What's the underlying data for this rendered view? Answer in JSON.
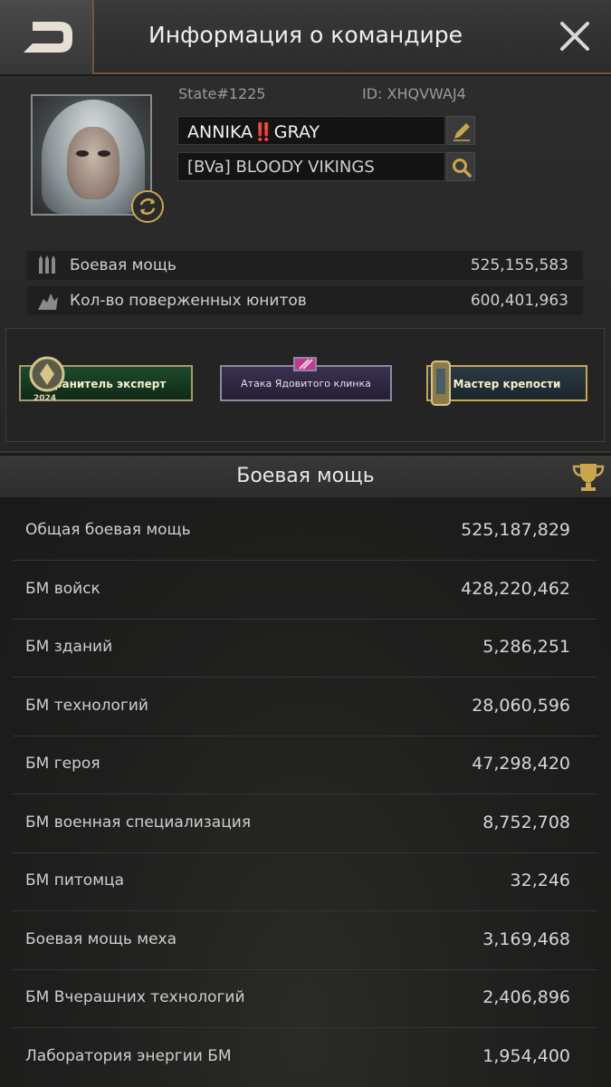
{
  "header": {
    "title": "Информация о командире"
  },
  "profile": {
    "state": "State#1225",
    "player_id": "ID: XHQVWAJ4",
    "name": "ANNIKA‼️GRAY",
    "alliance": "[BVa] BLOODY VIKINGS"
  },
  "stats": [
    {
      "icon": "bullets-icon",
      "label": "Боевая мощь",
      "value": "525,155,583"
    },
    {
      "icon": "kills-icon",
      "label": "Кол-во поверженных юнитов",
      "value": "600,401,963"
    }
  ],
  "badges": [
    {
      "label": "Хранитель эксперт",
      "year": "2024"
    },
    {
      "label": "Атака Ядовитого клинка"
    },
    {
      "label": "Мастер крепости"
    }
  ],
  "power": {
    "title": "Боевая мощь",
    "rows": [
      {
        "label": "Общая боевая мощь",
        "value": "525,187,829"
      },
      {
        "label": "БМ войск",
        "value": "428,220,462"
      },
      {
        "label": "БМ зданий",
        "value": "5,286,251"
      },
      {
        "label": "БМ технологий",
        "value": "28,060,596"
      },
      {
        "label": "БМ героя",
        "value": "47,298,420"
      },
      {
        "label": "БМ военная специализация",
        "value": "8,752,708"
      },
      {
        "label": "БМ питомца",
        "value": "32,246"
      },
      {
        "label": "Боевая мощь меха",
        "value": "3,169,468"
      },
      {
        "label": "БМ Вчерашних технологий",
        "value": "2,406,896"
      },
      {
        "label": "Лаборатория энергии БМ",
        "value": "1,954,400"
      }
    ]
  },
  "colors": {
    "accent_gold": "#c9a550",
    "panel_dark": "#1b1b1b"
  }
}
